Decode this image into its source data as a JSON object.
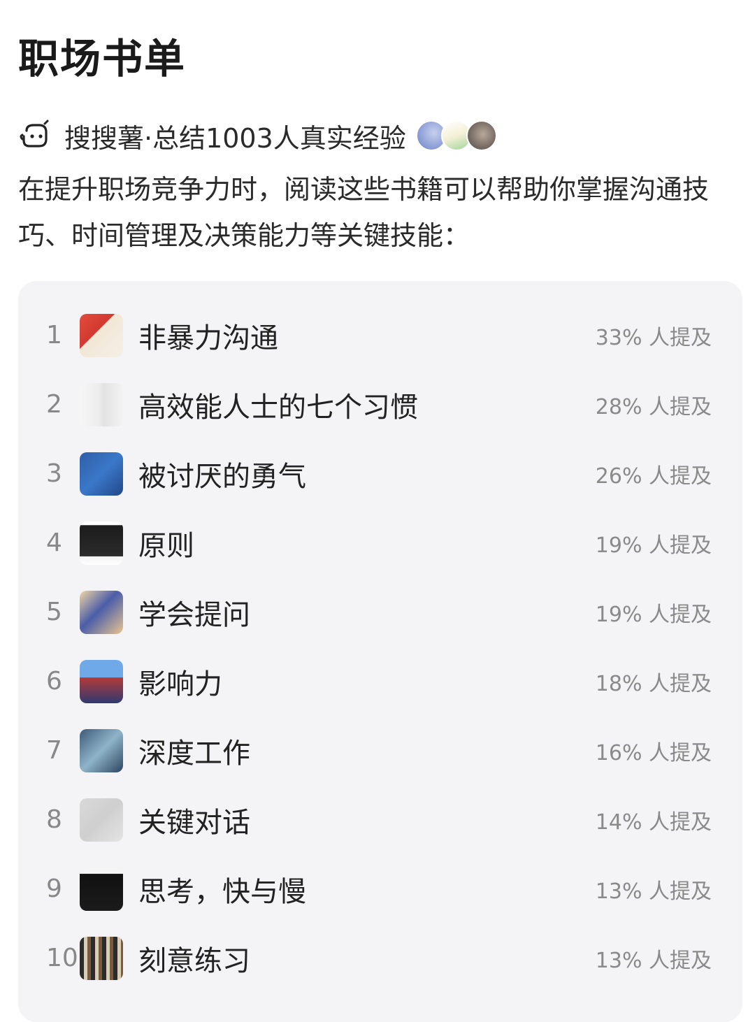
{
  "page": {
    "title": "职场书单"
  },
  "source": {
    "text": "搜搜薯·总结1003人真实经验",
    "icon": "robot-icon",
    "avatars": [
      "avatar-blue-sky",
      "avatar-green-house",
      "avatar-grey-portrait"
    ]
  },
  "intro": {
    "text": "在提升职场竞争力时，阅读这些书籍可以帮助你掌握沟通技巧、时间管理及决策能力等关键技能："
  },
  "books": [
    {
      "rank": "1",
      "title": "非暴力沟通",
      "mention": "33% 人提及"
    },
    {
      "rank": "2",
      "title": "高效能人士的七个习惯",
      "mention": "28% 人提及"
    },
    {
      "rank": "3",
      "title": "被讨厌的勇气",
      "mention": "26% 人提及"
    },
    {
      "rank": "4",
      "title": "原则",
      "mention": "19% 人提及"
    },
    {
      "rank": "5",
      "title": "学会提问",
      "mention": "19% 人提及"
    },
    {
      "rank": "6",
      "title": "影响力",
      "mention": "18% 人提及"
    },
    {
      "rank": "7",
      "title": "深度工作",
      "mention": "16% 人提及"
    },
    {
      "rank": "8",
      "title": "关键对话",
      "mention": "14% 人提及"
    },
    {
      "rank": "9",
      "title": "思考，快与慢",
      "mention": "13% 人提及"
    },
    {
      "rank": "10",
      "title": "刻意练习",
      "mention": "13% 人提及"
    }
  ]
}
